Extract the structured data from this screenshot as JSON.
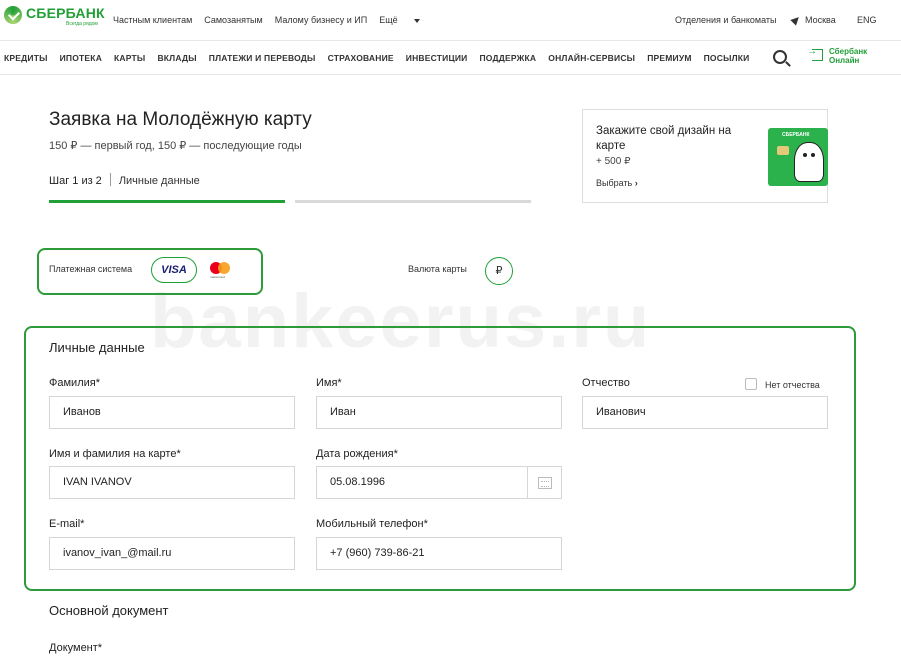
{
  "header": {
    "logo_text": "СБЕРБАНК",
    "logo_tagline": "Всегда рядом",
    "top_links": [
      "Частным клиентам",
      "Самозанятым",
      "Малому бизнесу и ИП",
      "Ещё"
    ],
    "branches": "Отделения и банкоматы",
    "city": "Москва",
    "lang": "ENG"
  },
  "nav": {
    "items": [
      "КРЕДИТЫ",
      "ИПОТЕКА",
      "КАРТЫ",
      "ВКЛАДЫ",
      "ПЛАТЕЖИ И ПЕРЕВОДЫ",
      "СТРАХОВАНИЕ",
      "ИНВЕСТИЦИИ",
      "ПОДДЕРЖКА",
      "ОНЛАЙН-СЕРВИСЫ",
      "ПРЕМИУМ",
      "ПОСЫЛКИ"
    ],
    "online_line1": "Сбербанк",
    "online_line2": "Онлайн"
  },
  "page": {
    "title": "Заявка на Молодёжную карту",
    "subtitle": "150 ₽ — первый год, 150 ₽ — последующие годы",
    "step": "Шаг 1 из 2",
    "step_name": "Личные данные",
    "progress_fraction": 0.5
  },
  "promo": {
    "title": "Закажите свой дизайн на карте",
    "price": "+ 500 ₽",
    "link": "Выбрать",
    "card_logo": "СБЕРБАНК"
  },
  "payment": {
    "label": "Платежная система",
    "visa": "VISA",
    "mastercard": "mastercard",
    "currency_label": "Валюта карты",
    "currency_symbol": "₽"
  },
  "watermark": "bankeerus.ru",
  "personal": {
    "title": "Личные данные",
    "surname_label": "Фамилия*",
    "surname_value": "Иванов",
    "name_label": "Имя*",
    "name_value": "Иван",
    "patronymic_label": "Отчество",
    "patronymic_value": "Иванович",
    "no_patronymic_label": "Нет отчества",
    "card_name_label": "Имя и фамилия на карте*",
    "card_name_value": "IVAN IVANOV",
    "birth_label": "Дата рождения*",
    "birth_value": "05.08.1996",
    "email_label": "E-mail*",
    "email_value": "ivanov_ivan_@mail.ru",
    "phone_label": "Мобильный телефон*",
    "phone_value": "+7 (960) 739-86-21"
  },
  "document": {
    "title": "Основной документ",
    "doc_label": "Документ*"
  },
  "colors": {
    "brand_green": "#21a038",
    "highlight_green": "#2d9b3a"
  }
}
